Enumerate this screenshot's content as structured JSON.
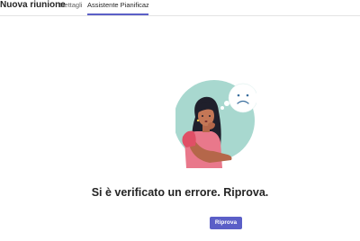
{
  "header": {
    "title": "Nuova riunione",
    "tabs": [
      {
        "label": "Dettagli",
        "active": false
      },
      {
        "label": "Assistente Pianificazi...",
        "active": true
      }
    ]
  },
  "main": {
    "illustration_icon": "woman-thinking-sad-face-illustration",
    "error_message": "Si è verificato un errore. Riprova.",
    "retry_label": "Riprova"
  },
  "colors": {
    "accent": "#5b5fc7",
    "illustration_bg": "#a8d8cf",
    "text": "#242424"
  }
}
